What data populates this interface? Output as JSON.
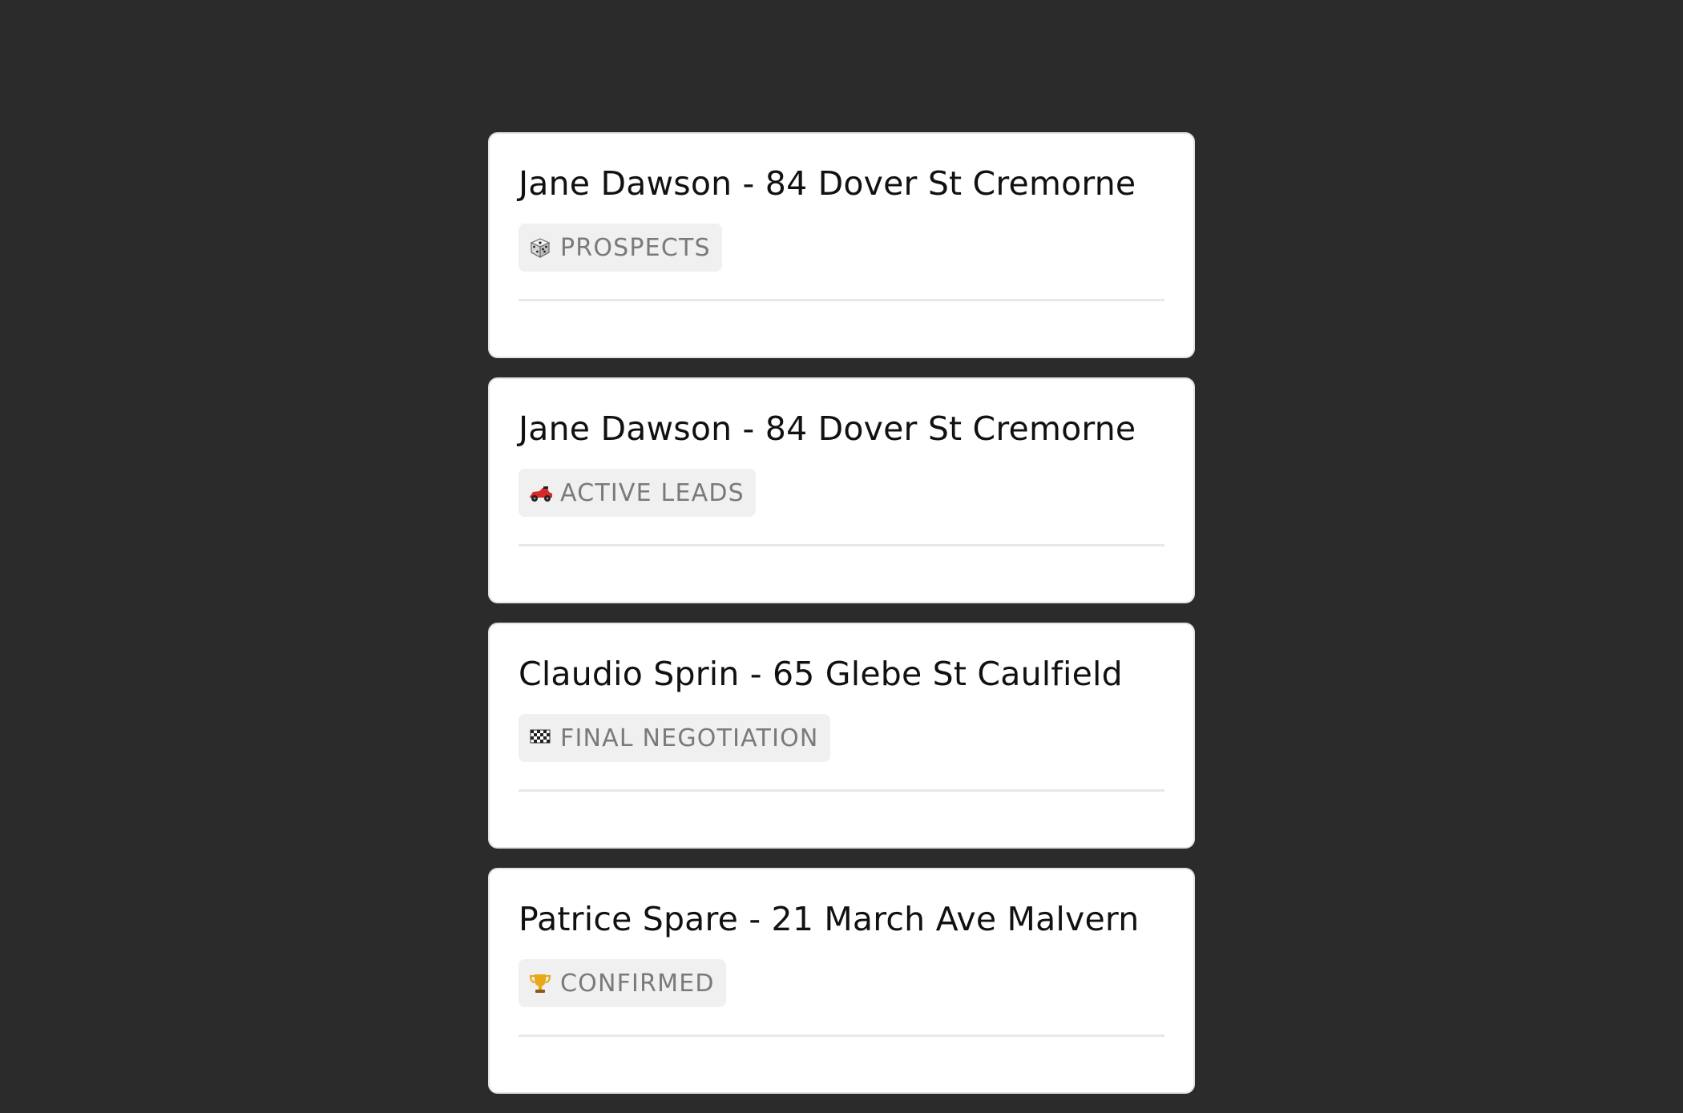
{
  "cards": [
    {
      "title": "Jane Dawson - 84 Dover St Cremorne",
      "tag": {
        "icon": "dice-icon",
        "label": "PROSPECTS"
      }
    },
    {
      "title": "Jane Dawson - 84 Dover St Cremorne",
      "tag": {
        "icon": "race-car-icon",
        "label": "ACTIVE LEADS"
      }
    },
    {
      "title": "Claudio Sprin - 65 Glebe St Caulfield",
      "tag": {
        "icon": "checkered-flag-icon",
        "label": "FINAL NEGOTIATION"
      }
    },
    {
      "title": "Patrice Spare - 21 March Ave Malvern",
      "tag": {
        "icon": "trophy-icon",
        "label": "CONFIRMED"
      }
    }
  ],
  "colors": {
    "background": "#2b2b2b",
    "card": "#ffffff",
    "tag_background": "#f0f0f0",
    "tag_text": "#7a7a7a",
    "title_text": "#111111"
  }
}
